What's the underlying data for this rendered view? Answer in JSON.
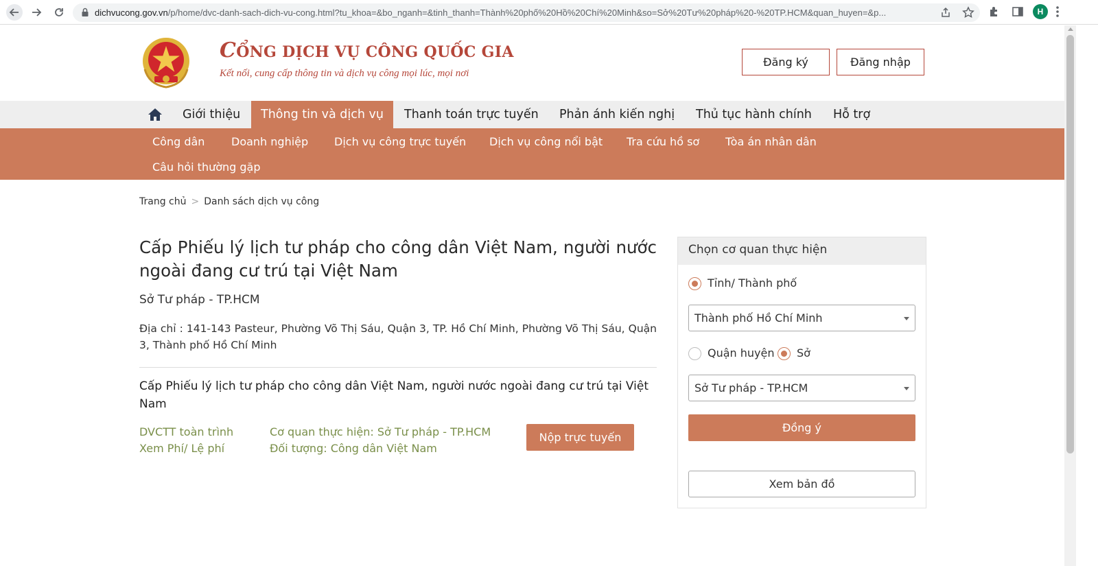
{
  "browser": {
    "url_host": "dichvucong.gov.vn",
    "url_path": "/p/home/dvc-danh-sach-dich-vu-cong.html?tu_khoa=&bo_nganh=&tinh_thanh=Thành%20phố%20Hồ%20Chí%20Minh&so=Sở%20Tư%20pháp%20-%20TP.HCM&quan_huyen=&p...",
    "profile_initial": "H"
  },
  "header": {
    "brand_first_letter": "C",
    "brand_rest": "ỔNG DỊCH VỤ CÔNG QUỐC GIA",
    "tagline": "Kết nối, cung cấp thông tin và dịch vụ công mọi lúc, mọi nơi",
    "register_label": "Đăng ký",
    "login_label": "Đăng nhập"
  },
  "nav": {
    "items": [
      "Giới thiệu",
      "Thông tin và dịch vụ",
      "Thanh toán trực tuyến",
      "Phản ánh kiến nghị",
      "Thủ tục hành chính",
      "Hỗ trợ"
    ],
    "active_index": 1
  },
  "subnav": {
    "items": [
      "Công dân",
      "Doanh nghiệp",
      "Dịch vụ công trực tuyến",
      "Dịch vụ công nổi bật",
      "Tra cứu hồ sơ",
      "Tòa án nhân dân",
      "Câu hỏi thường gặp"
    ]
  },
  "breadcrumb": {
    "home": "Trang chủ",
    "separator": ">",
    "current": "Danh sách dịch vụ công"
  },
  "content": {
    "title": "Cấp Phiếu lý lịch tư pháp cho công dân Việt Nam, người nước ngoài đang cư trú tại Việt Nam",
    "agency": "Sở Tư pháp - TP.HCM",
    "address": "Địa chỉ : 141-143 Pasteur, Phường Võ Thị Sáu, Quận 3, TP. Hồ Chí Minh, Phường Võ Thị Sáu, Quận 3, Thành phố Hồ Chí Minh",
    "service": {
      "name": "Cấp Phiếu lý lịch tư pháp cho công dân Việt Nam, người nước ngoài đang cư trú tại Việt Nam",
      "level": "DVCTT toàn trình",
      "fee_link": "Xem Phí/ Lệ phí",
      "executing_agency": "Cơ quan thực hiện: Sở Tư pháp - TP.HCM",
      "target": "Đối tượng: Công dân Việt Nam",
      "submit_label": "Nộp trực tuyến"
    }
  },
  "panel": {
    "title": "Chọn cơ quan thực hiện",
    "radio_province": "Tỉnh/ Thành phố",
    "province_selected": "Thành phố Hồ Chí Minh",
    "radio_district": "Quận huyện",
    "radio_department": "Sở",
    "department_selected": "Sở Tư pháp - TP.HCM",
    "agree_label": "Đồng ý",
    "map_label": "Xem bản đồ"
  },
  "colors": {
    "accent": "#cc7b5a",
    "brand_red": "#b5473a",
    "link_green": "#7a8f4a"
  }
}
